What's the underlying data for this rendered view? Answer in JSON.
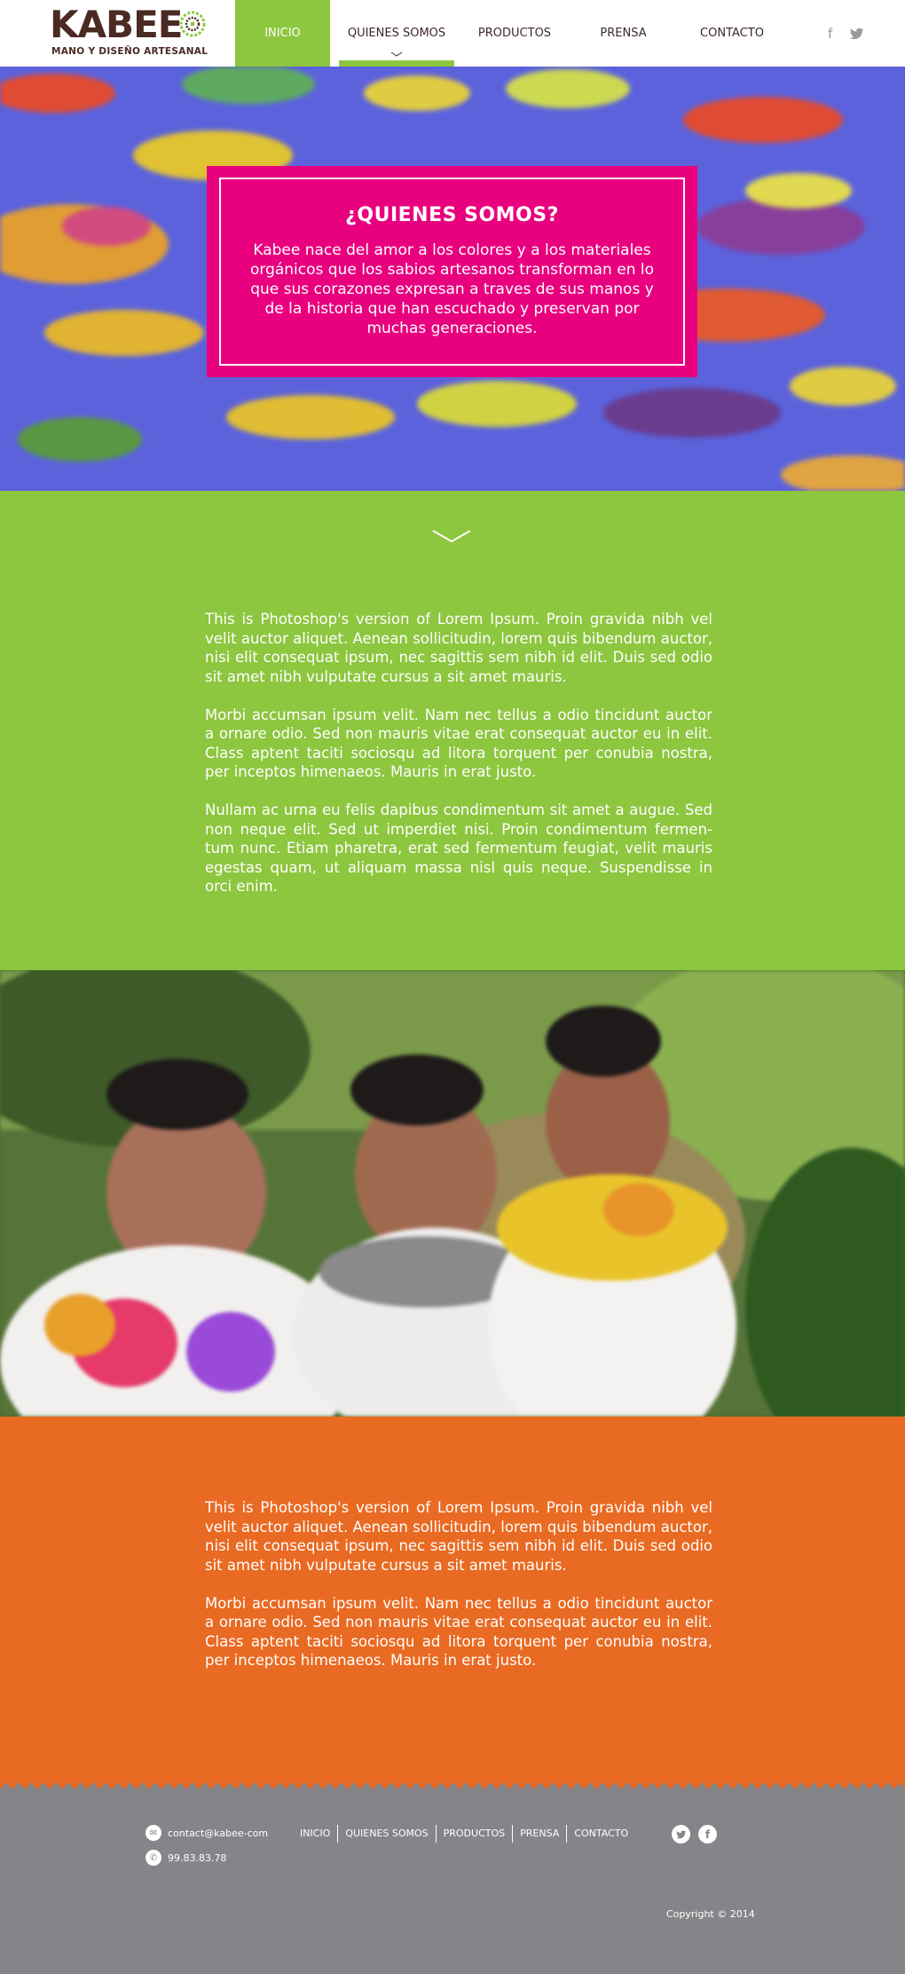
{
  "brand": {
    "name": "KABEE",
    "tagline": "MANO Y DISEÑO ARTESANAL"
  },
  "nav": {
    "items": [
      {
        "label": "INICIO"
      },
      {
        "label": "QUIENES SOMOS"
      },
      {
        "label": "PRODUCTOS"
      },
      {
        "label": "PRENSA"
      },
      {
        "label": "CONTACTO"
      }
    ],
    "active_index": 0,
    "current_index": 1
  },
  "social": {
    "facebook_glyph": "f",
    "twitter_glyph": "t"
  },
  "hero": {
    "title": "¿QUIENES SOMOS?",
    "text": "Kabee nace del amor a los colores y a los materiales orgánicos que los sabios artesanos transforman en lo que sus  corazones  expresan a traves de sus manos y de la historia que han escuchado y preservan por muchas generaciones."
  },
  "green_section": {
    "paragraphs": [
      "This is Photoshop's version  of Lorem Ipsum. Proin gravida nibh vel velit auctor aliquet. Aenean sollicitudin, lorem quis bibendum auctor, nisi elit consequat ipsum, nec sagittis sem nibh id elit. Duis sed odio sit amet nibh vulputate cursus a sit amet mauris.",
      " Morbi accumsan ipsum velit. Nam nec tellus a odio tincidunt auctor a ornare odio. Sed non  mauris vitae erat consequat auctor eu in elit. Class aptent taciti sociosqu ad litora torquent per conubia nostra, per inceptos himenaeos. Mauris in erat justo.",
      "Nullam ac urna eu felis dapibus condimentum sit amet a augue. Sed non neque elit. Sed ut imperdiet nisi. Proin condimentum fermen-tum nunc. Etiam pharetra, erat sed fermentum feugiat, velit mauris egestas quam, ut aliquam massa nisl quis neque. Suspendisse in orci enim."
    ]
  },
  "orange_section": {
    "paragraphs": [
      "This is Photoshop's version  of Lorem Ipsum. Proin gravida nibh vel velit auctor aliquet. Aenean sollicitudin, lorem quis bibendum auctor, nisi elit consequat ipsum, nec sagittis sem nibh id elit. Duis sed odio sit amet nibh vulputate cursus a sit amet mauris.",
      " Morbi accumsan ipsum velit. Nam nec tellus a odio tincidunt auctor a ornare odio. Sed non  mauris vitae erat consequat auctor eu in elit. Class aptent taciti sociosqu ad litora torquent per conubia nostra, per inceptos himenaeos. Mauris in erat justo."
    ]
  },
  "footer": {
    "email": "contact@kabee-com",
    "phone": "99.83.83.78",
    "nav": [
      "INICIO",
      "QUIENES SOMOS",
      "PRODUCTOS",
      "PRENSA",
      "CONTACTO"
    ],
    "copyright": "Copyright © 2014"
  },
  "colors": {
    "green": "#8dc63f",
    "magenta": "#e8007e",
    "orange": "#e96a22",
    "footer_gray": "#858589",
    "brand_brown": "#4a2a22"
  }
}
